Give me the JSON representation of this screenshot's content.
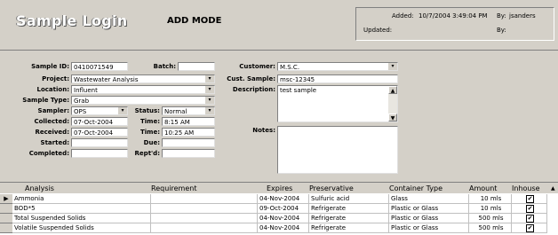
{
  "header": {
    "title": "Sample Login",
    "mode": "ADD MODE",
    "added_label": "Added:",
    "added_value": "10/7/2004 3:49:04 PM",
    "by_label": "By:",
    "by_value": "jsanders",
    "updated_label": "Updated:",
    "updated_value": "",
    "by2_label": "By:",
    "by2_value": ""
  },
  "form": {
    "sample_id_label": "Sample ID:",
    "sample_id": "0410071549",
    "batch_label": "Batch:",
    "batch": "",
    "project_label": "Project:",
    "project": "Wastewater Analysis",
    "location_label": "Location:",
    "location": "Influent",
    "sample_type_label": "Sample Type:",
    "sample_type": "Grab",
    "sampler_label": "Sampler:",
    "sampler": "OPS",
    "status_label": "Status:",
    "status": "Normal",
    "collected_label": "Collected:",
    "collected": "07-Oct-2004",
    "time1_label": "Time:",
    "time1": "8:15 AM",
    "received_label": "Received:",
    "received": "07-Oct-2004",
    "time2_label": "Time:",
    "time2": "10:25 AM",
    "started_label": "Started:",
    "started": "",
    "due_label": "Due:",
    "due": "",
    "completed_label": "Completed:",
    "completed": "",
    "reptd_label": "Rept'd:",
    "reptd": "",
    "customer_label": "Customer:",
    "customer": "M.S.C.",
    "cust_sample_label": "Cust. Sample:",
    "cust_sample": "msc-12345",
    "description_label": "Description:",
    "description": "test sample",
    "notes_label": "Notes:",
    "notes": ""
  },
  "grid": {
    "columns": [
      "Analysis",
      "Requirement",
      "Expires",
      "Preservative",
      "Container Type",
      "Amount",
      "Inhouse"
    ],
    "rows": [
      {
        "selector": "▶",
        "analysis": "Ammonia",
        "requirement": "",
        "expires": "04-Nov-2004",
        "preservative": "Sulfuric acid",
        "container": "Glass",
        "amount": "10 mls",
        "inhouse": "✔"
      },
      {
        "selector": "",
        "analysis": "BOD*5",
        "requirement": "",
        "expires": "09-Oct-2004",
        "preservative": "Refrigerate",
        "container": "Plastic or Glass",
        "amount": "10 mls",
        "inhouse": "✔"
      },
      {
        "selector": "",
        "analysis": "Total Suspended Solids",
        "requirement": "",
        "expires": "04-Nov-2004",
        "preservative": "Refrigerate",
        "container": "Plastic or Glass",
        "amount": "500 mls",
        "inhouse": "✔"
      },
      {
        "selector": "",
        "analysis": "Volatile Suspended Solids",
        "requirement": "",
        "expires": "04-Nov-2004",
        "preservative": "Refrigerate",
        "container": "Plastic or Glass",
        "amount": "500 mls",
        "inhouse": "✔"
      }
    ]
  },
  "icons": {
    "dropdown": "▾",
    "up": "▲",
    "down": "▼",
    "sort": "▲"
  },
  "colors": {
    "face": "#d4d0c8",
    "field": "#ffffff"
  }
}
